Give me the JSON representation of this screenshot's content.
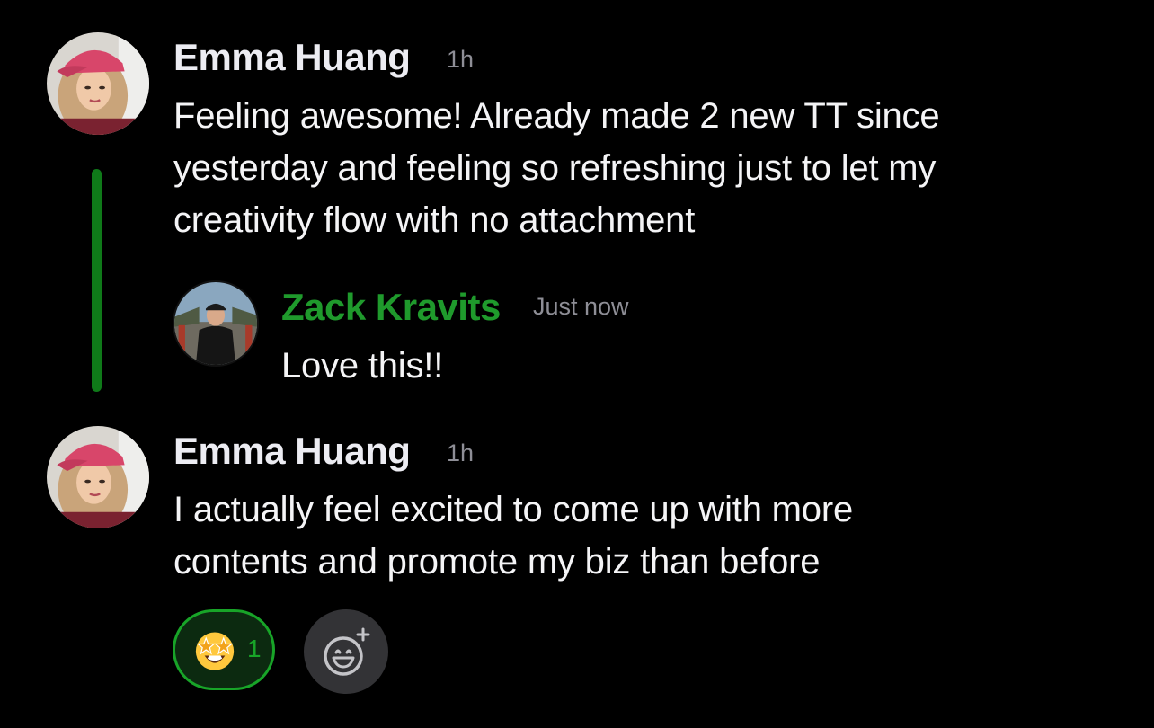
{
  "messages": [
    {
      "author": "Emma Huang",
      "time": "1h",
      "text": "Feeling awesome! Already made 2 new TT since yesterday and feeling so refreshing just to let my creativity flow with no attachment",
      "lines": [
        "Feeling awesome! Already made 2 new TT since",
        "yesterday and feeling so refreshing just to let my",
        "creativity flow with no attachment"
      ]
    },
    {
      "author": "Zack Kravits",
      "time": "Just now",
      "text": "Love this!!"
    },
    {
      "author": "Emma Huang",
      "time": "1h",
      "text": "I actually feel excited to come up with more contents and promote my biz than before",
      "lines": [
        "I actually feel excited to come up with more",
        "contents and promote my biz than before"
      ]
    }
  ],
  "reactions": [
    {
      "emoji": "star-struck-emoji",
      "count": "1",
      "selected": true
    }
  ],
  "add_reaction_icon": "add-reaction-icon",
  "colors": {
    "background": "#000000",
    "accent_green": "#18a428",
    "reply_author_green": "#1f9a2c",
    "thread_line": "#0f7a19",
    "timestamp": "#8e8e96",
    "text": "#f4f4f6"
  }
}
